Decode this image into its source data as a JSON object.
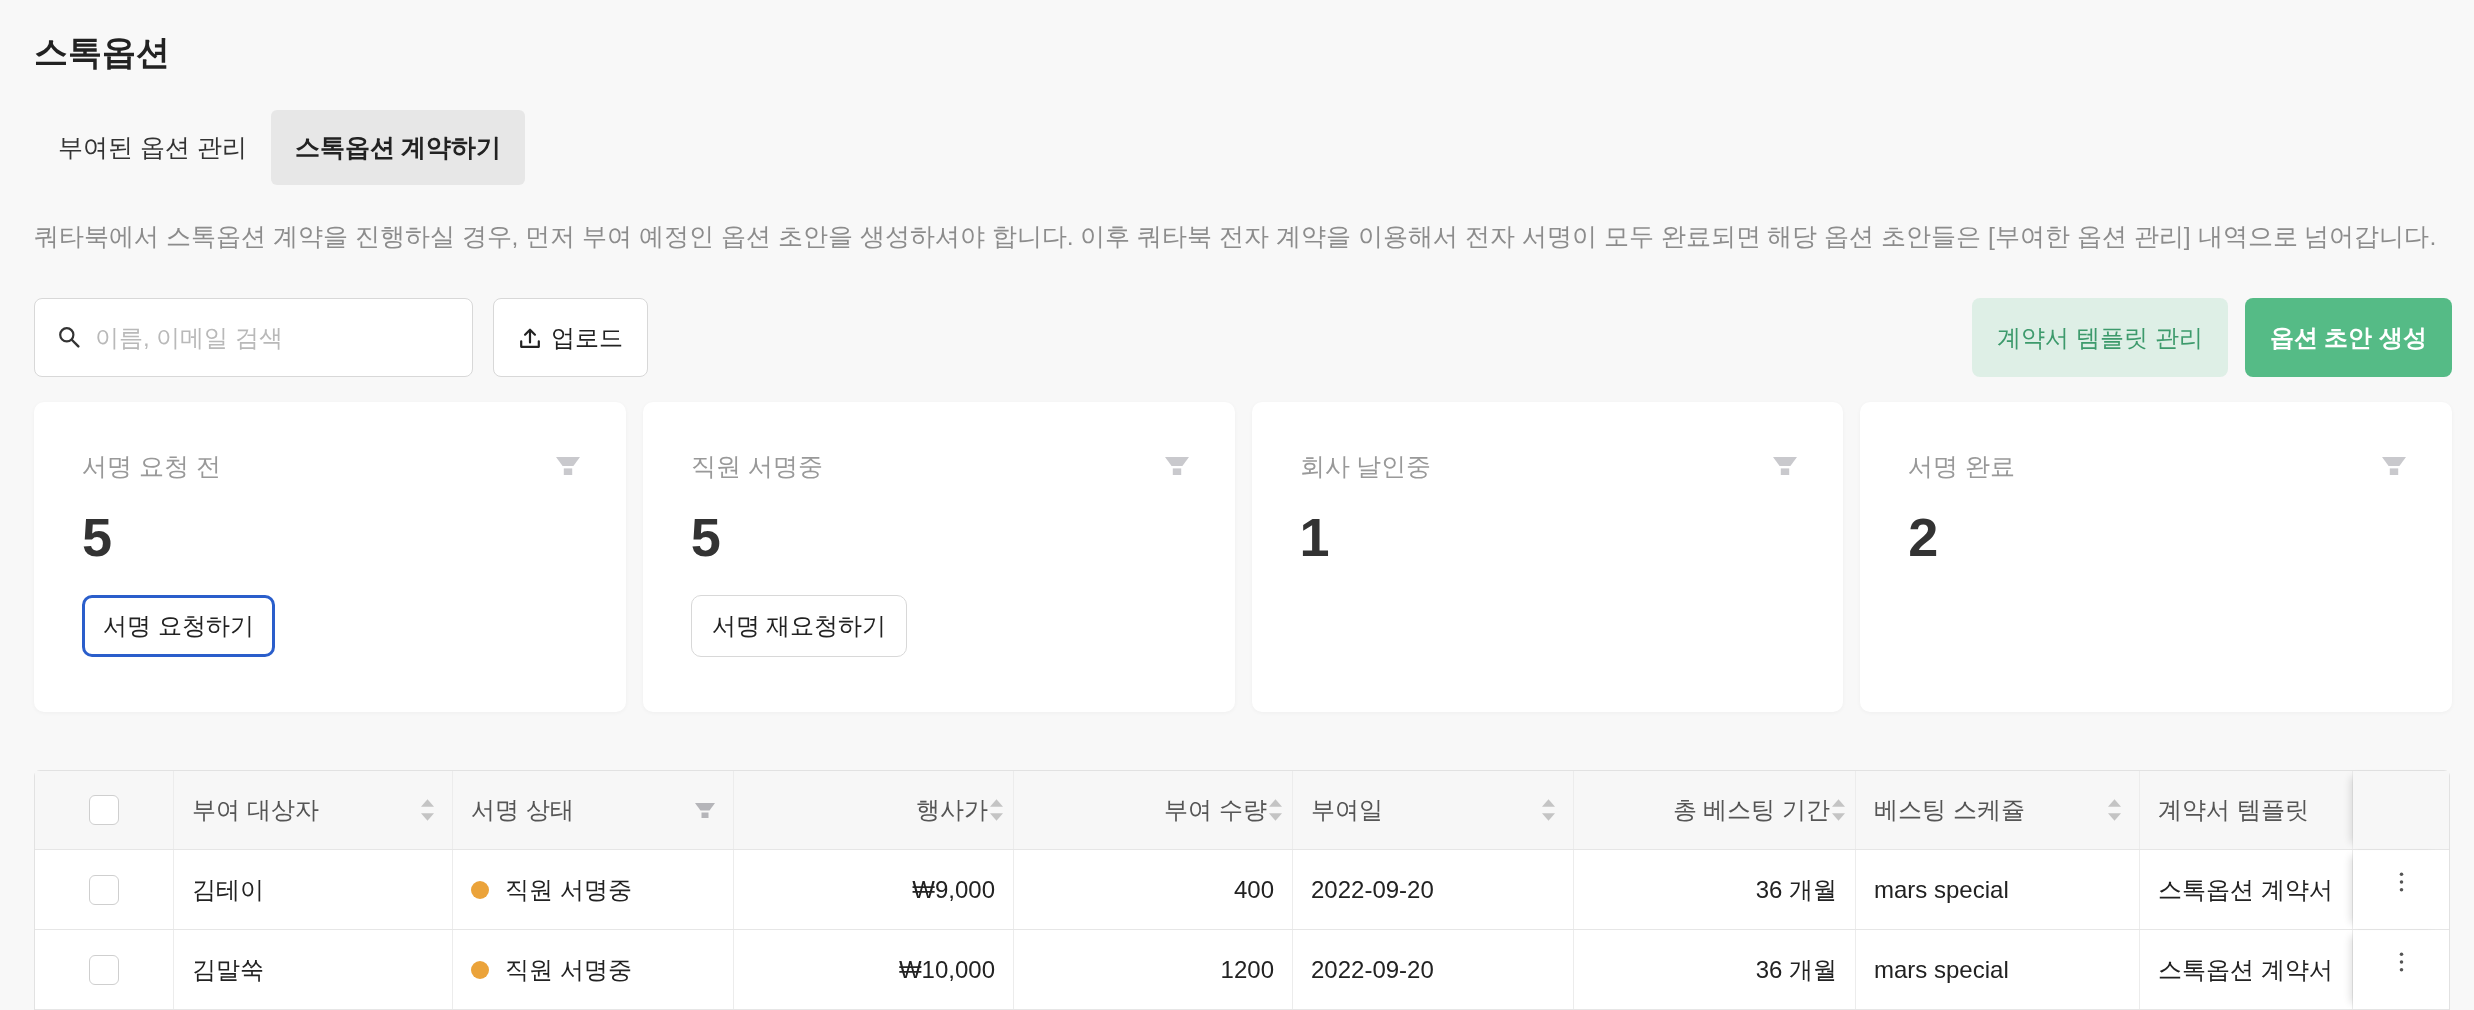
{
  "page": {
    "title": "스톡옵션"
  },
  "tabs": [
    {
      "label": "부여된 옵션 관리",
      "selected": false
    },
    {
      "label": "스톡옵션 계약하기",
      "selected": true
    }
  ],
  "description": "쿼타북에서 스톡옵션 계약을 진행하실 경우, 먼저 부여 예정인 옵션 초안을 생성하셔야 합니다. 이후 쿼타북 전자 계약을 이용해서 전자 서명이 모두 완료되면 해당 옵션 초안들은 [부여한 옵션 관리] 내역으로 넘어갑니다.",
  "toolbar": {
    "search": {
      "placeholder": "이름, 이메일 검색"
    },
    "upload_button": "업로드",
    "template_button": "계약서 템플릿 관리",
    "create_button": "옵션 초안 생성"
  },
  "status_cards": [
    {
      "label": "서명 요청 전",
      "count": "5",
      "action": {
        "label": "서명 요청하기",
        "focused": true
      }
    },
    {
      "label": "직원 서명중",
      "count": "5",
      "action": {
        "label": "서명 재요청하기",
        "focused": false
      }
    },
    {
      "label": "회사 날인중",
      "count": "1"
    },
    {
      "label": "서명 완료",
      "count": "2"
    }
  ],
  "table": {
    "select_all_checked": false,
    "columns": [
      {
        "label": "부여 대상자",
        "kind": "text",
        "sortable": true,
        "filterable": false
      },
      {
        "label": "서명 상태",
        "kind": "status",
        "sortable": false,
        "filterable": true
      },
      {
        "label": "행사가",
        "kind": "number",
        "sortable": true,
        "filterable": false
      },
      {
        "label": "부여 수량",
        "kind": "number",
        "sortable": true,
        "filterable": false
      },
      {
        "label": "부여일",
        "kind": "text",
        "sortable": true,
        "filterable": false
      },
      {
        "label": "총 베스팅 기간",
        "kind": "number",
        "sortable": true,
        "filterable": false
      },
      {
        "label": "베스팅 스케쥴",
        "kind": "text",
        "sortable": true,
        "filterable": false
      },
      {
        "label": "계약서 템플릿",
        "kind": "text",
        "sortable": false,
        "filterable": false
      }
    ],
    "rows": [
      {
        "checked": false,
        "cells": [
          "김테이",
          {
            "text": "직원 서명중",
            "color": "#eba33a"
          },
          "₩9,000",
          "400",
          "2022-09-20",
          "36 개월",
          "mars special",
          "스톡옵션 계약서"
        ]
      },
      {
        "checked": false,
        "cells": [
          "김말쑥",
          {
            "text": "직원 서명중",
            "color": "#eba33a"
          },
          "₩10,000",
          "1200",
          "2022-09-20",
          "36 개월",
          "mars special",
          "스톡옵션 계약서"
        ]
      }
    ]
  }
}
